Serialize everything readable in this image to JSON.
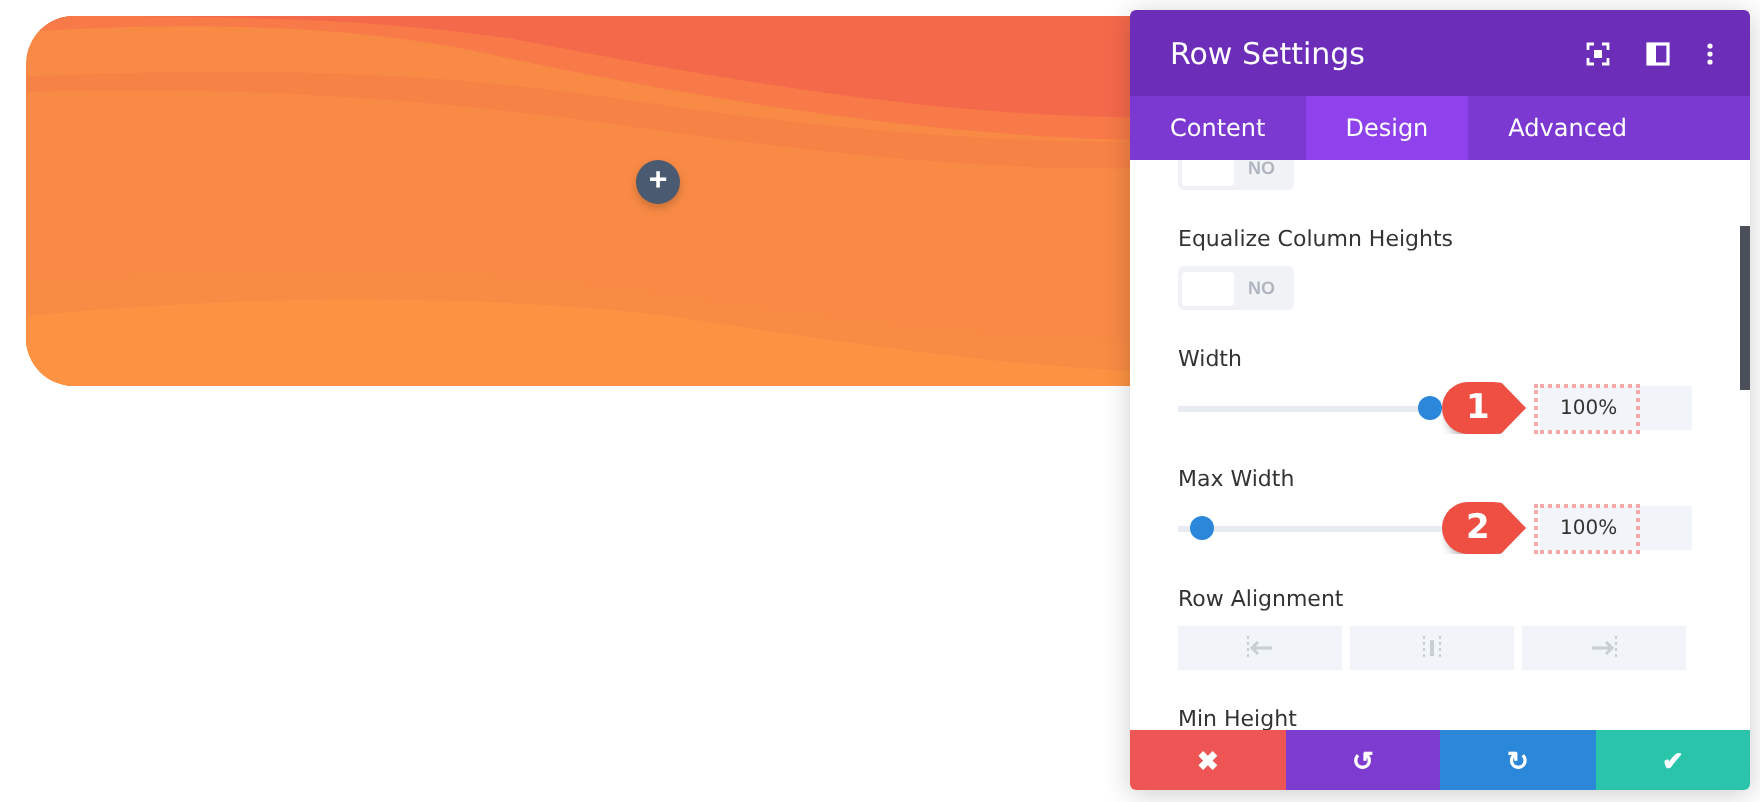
{
  "canvas": {
    "add_button": "+"
  },
  "panel": {
    "title": "Row Settings",
    "tabs": [
      {
        "label": "Content",
        "selected": false
      },
      {
        "label": "Design",
        "selected": true
      },
      {
        "label": "Advanced",
        "selected": false
      }
    ],
    "settings": [
      {
        "kind": "toggle",
        "value": "NO",
        "on": false
      },
      {
        "kind": "toggle",
        "label": "Equalize Column Heights",
        "value": "NO",
        "on": false
      },
      {
        "kind": "slider",
        "label": "Width",
        "level": 1,
        "value": "100%",
        "callout": "1"
      },
      {
        "kind": "slider",
        "label": "Max Width",
        "level": 0.05,
        "value": "100%",
        "callout": "2"
      },
      {
        "kind": "alignment",
        "label": "Row Alignment",
        "options": [
          {
            "selected": false
          },
          {
            "selected": false
          },
          {
            "selected": false
          }
        ]
      },
      {
        "kind": "heading",
        "label": "Min Height"
      }
    ],
    "footer": [
      "✖",
      "↺",
      "↻",
      "✔"
    ]
  }
}
